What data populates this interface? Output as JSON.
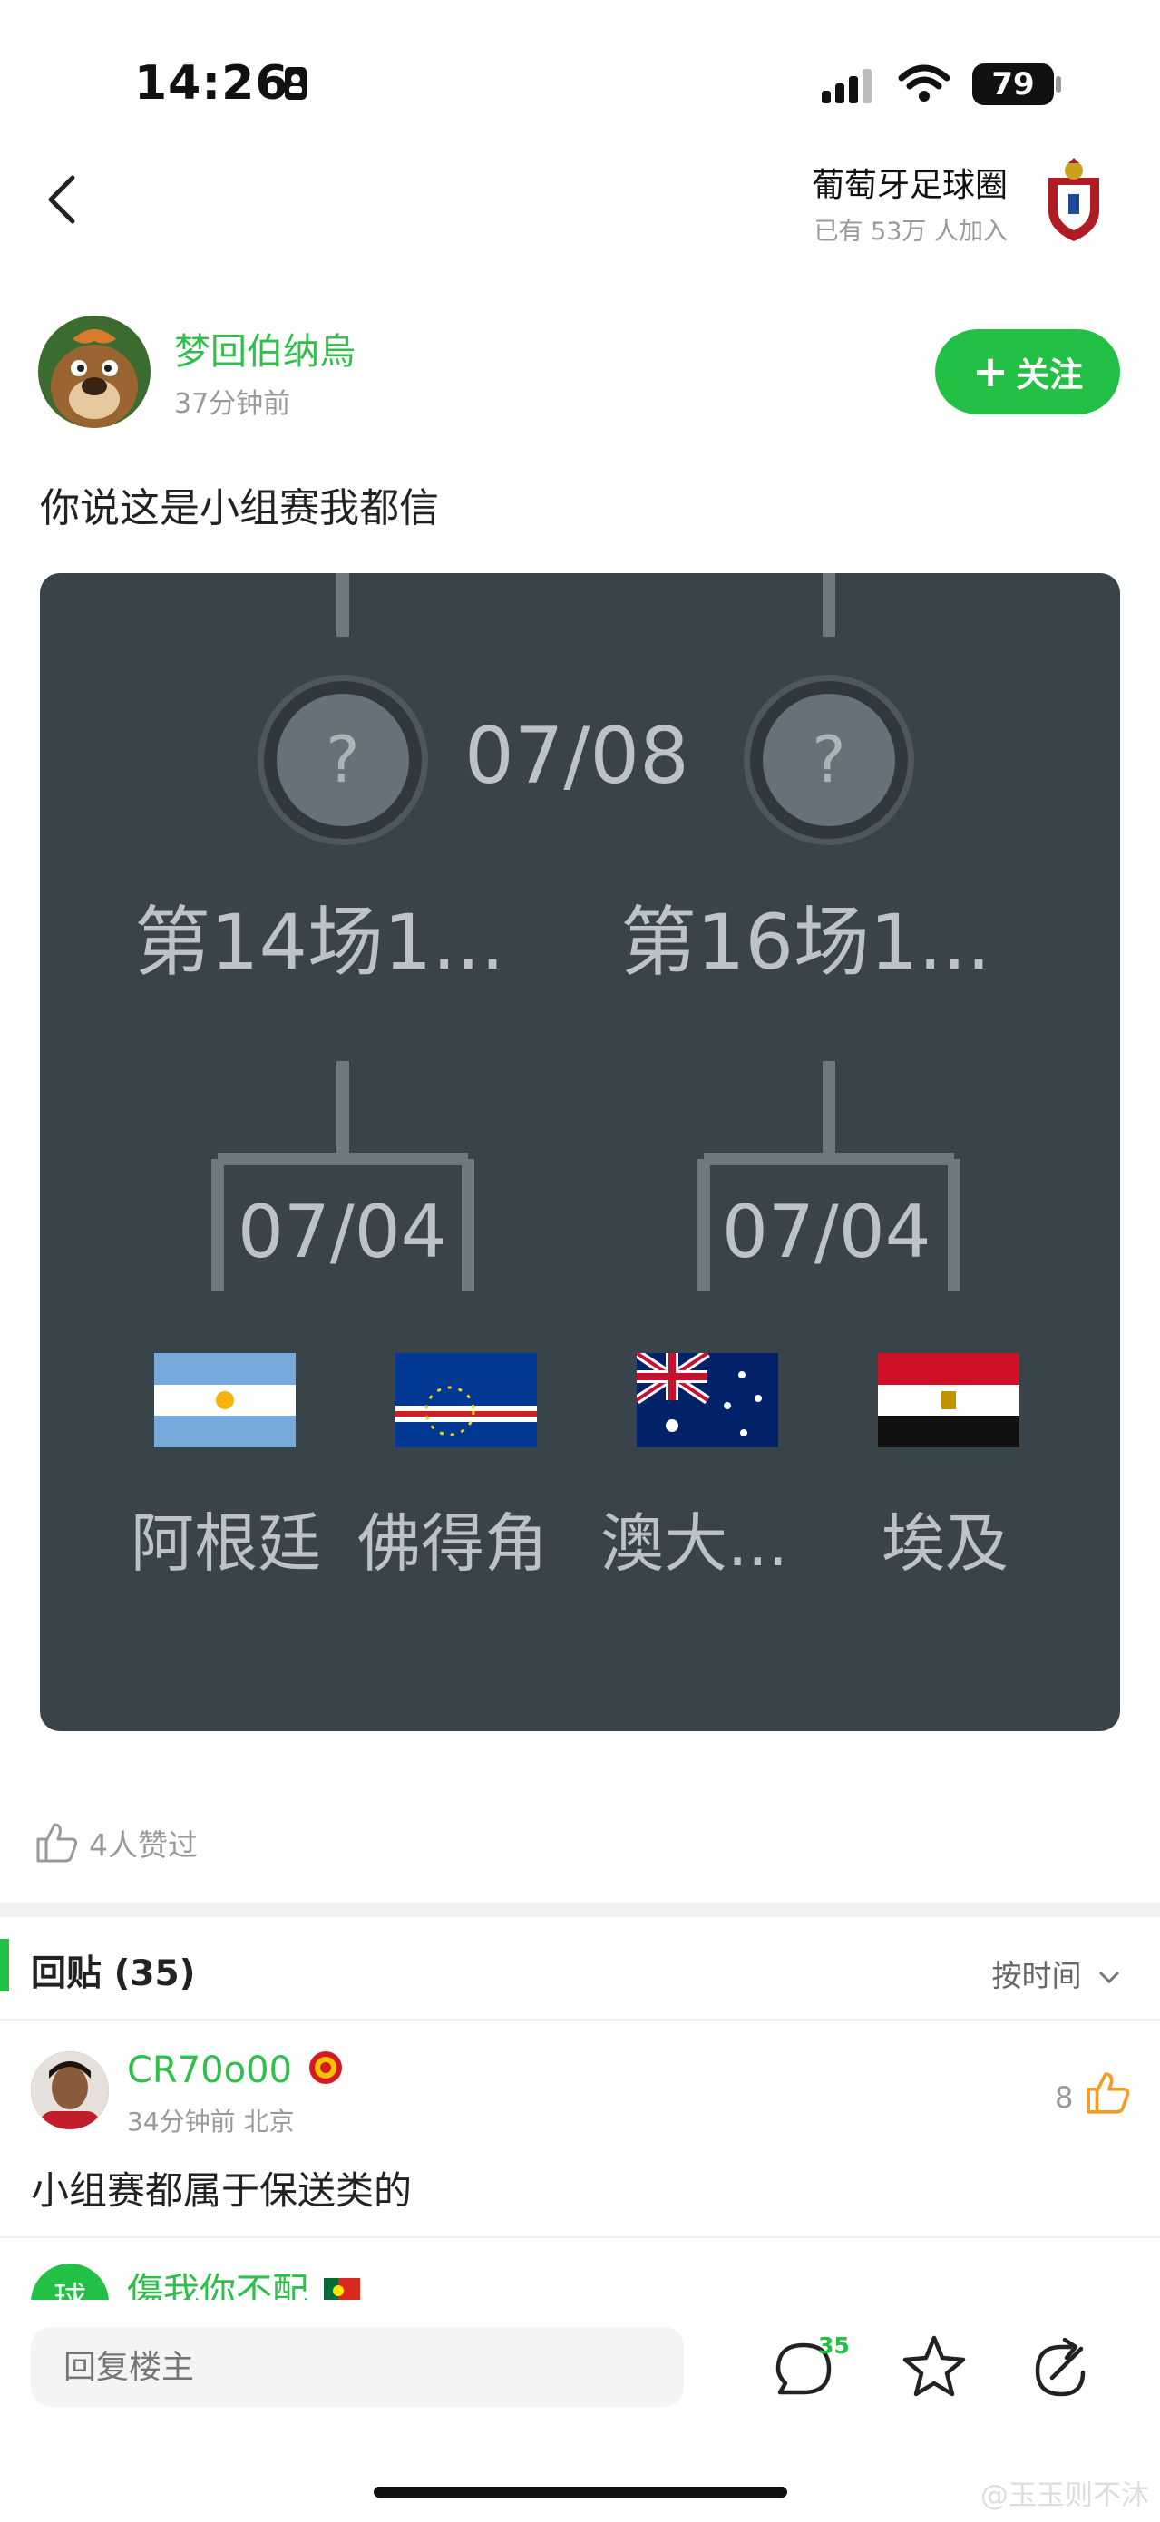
{
  "status_bar": {
    "time": "14:26",
    "battery": "79"
  },
  "header": {
    "forum_name": "葡萄牙足球圈",
    "members": "已有 53万 人加入"
  },
  "post": {
    "author": "梦回伯纳烏",
    "time": "37分钟前",
    "follow_label": "关注",
    "text": "你说这是小组赛我都信",
    "likes": "4人赞过"
  },
  "bracket": {
    "top_date": "07/08",
    "question": "?",
    "match_left": "第14场1...",
    "match_right": "第16场1...",
    "sub_date_left": "07/04",
    "sub_date_right": "07/04",
    "teams": [
      "阿根廷",
      "佛得角",
      "澳大...",
      "埃及"
    ]
  },
  "replies": {
    "title": "回贴 (35)",
    "sort": "按时间",
    "items": [
      {
        "name": "CR70o00",
        "meta": "34分钟前 北京",
        "likes": "8",
        "text": "小组赛都属于保送类的"
      },
      {
        "name": "傷我你不配",
        "avatar_text": "球"
      }
    ]
  },
  "bottom_bar": {
    "placeholder": "回复楼主",
    "comment_count": "35"
  },
  "watermark": "@玉玉则不沐",
  "colors": {
    "accent": "#22c145",
    "image_bg": "#39434a"
  }
}
